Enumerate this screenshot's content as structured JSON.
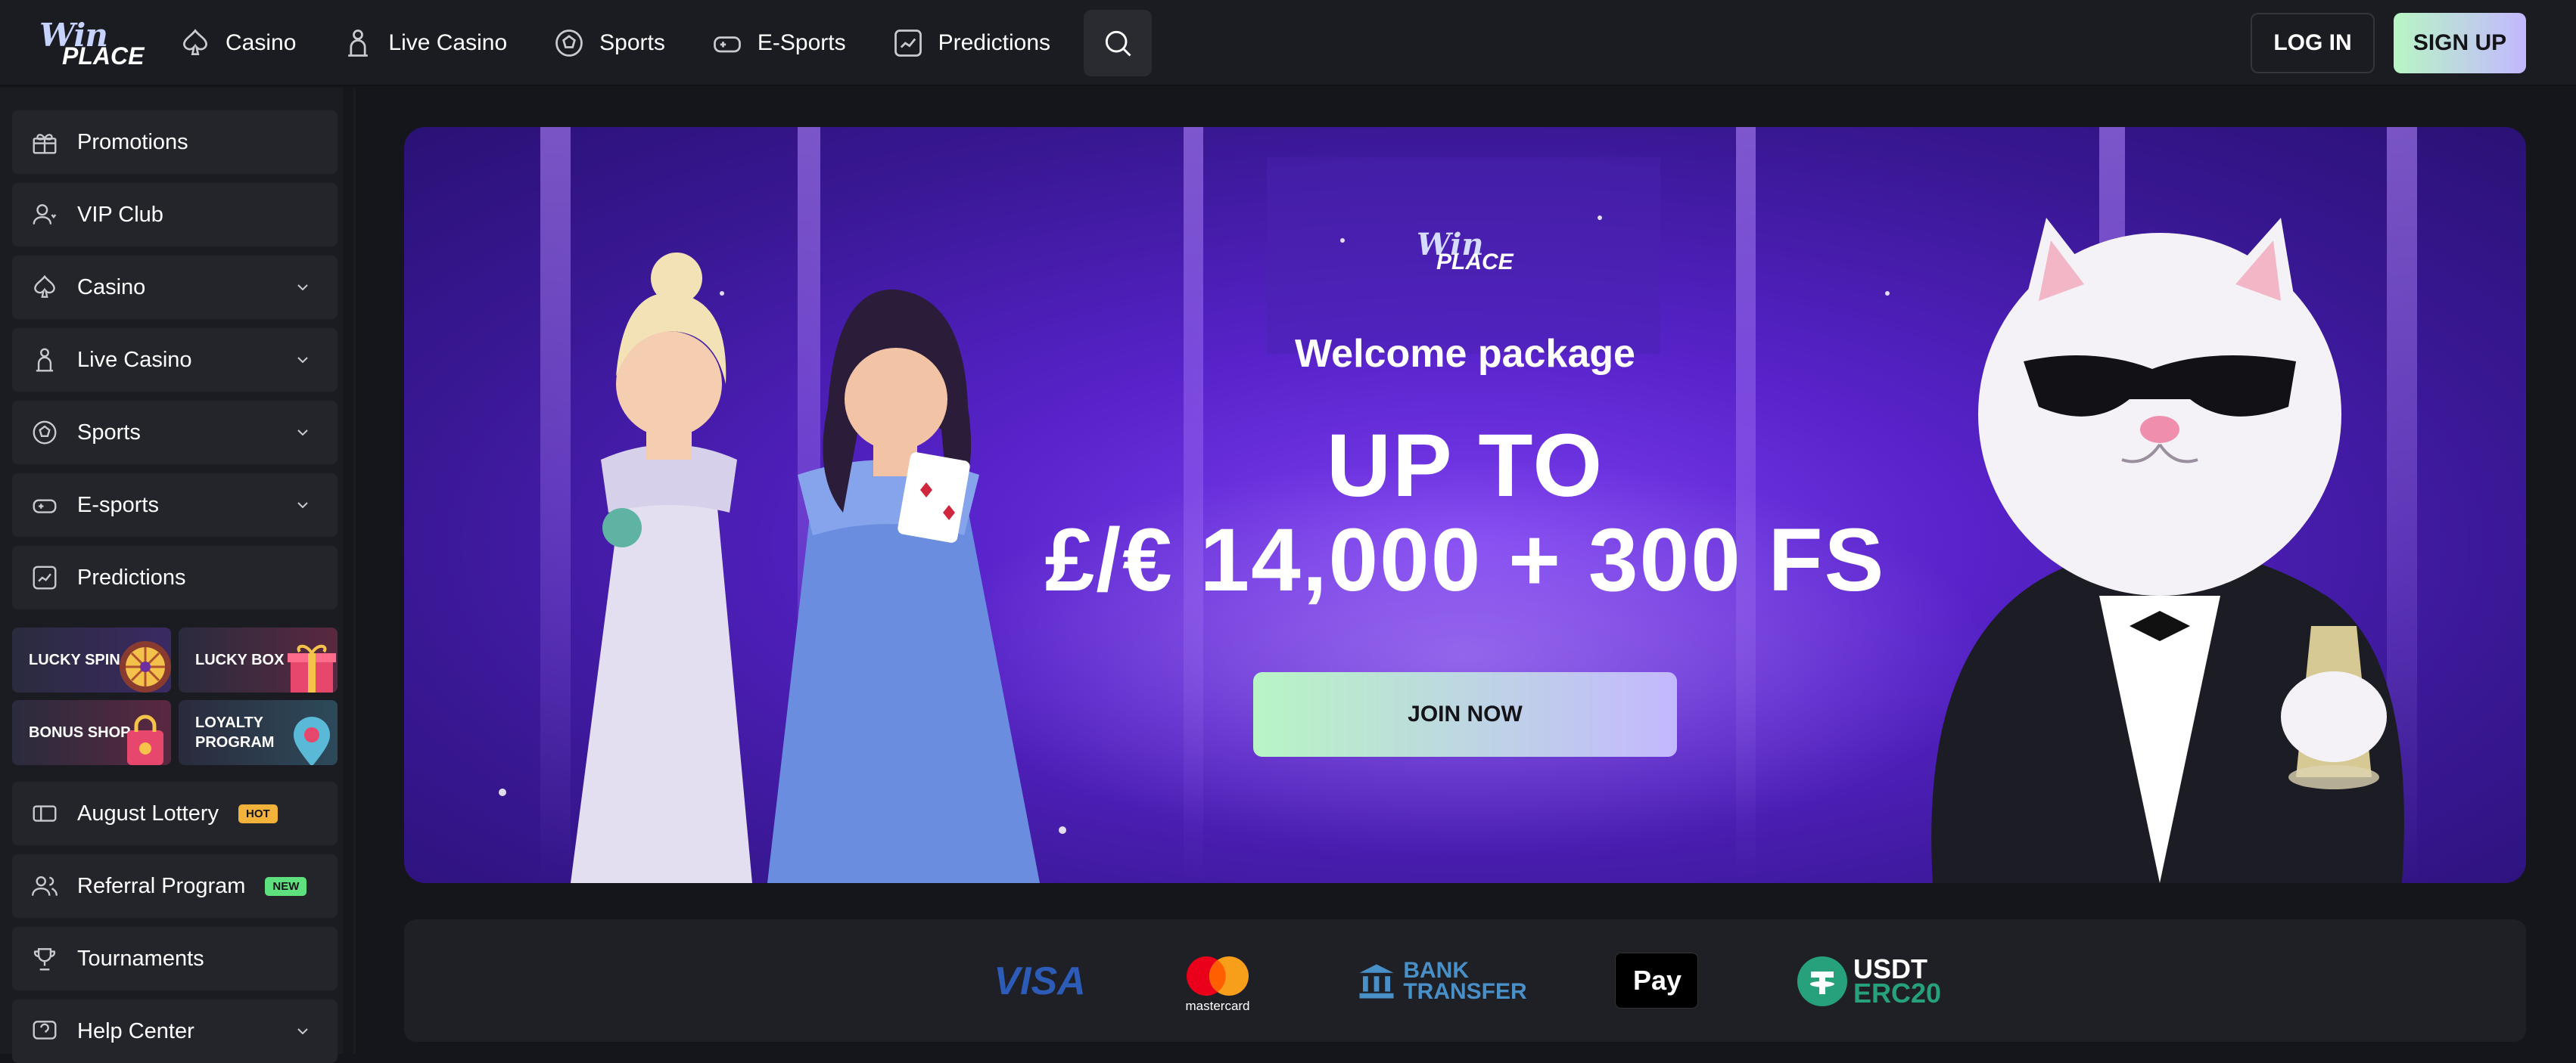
{
  "brand": {
    "logo_line1": "Win",
    "logo_line2": "PLACE"
  },
  "nav": [
    {
      "label": "Casino",
      "icon": "spade-icon"
    },
    {
      "label": "Live Casino",
      "icon": "dealer-icon"
    },
    {
      "label": "Sports",
      "icon": "soccer-ball-icon"
    },
    {
      "label": "E-Sports",
      "icon": "gamepad-icon"
    },
    {
      "label": "Predictions",
      "icon": "chart-icon"
    }
  ],
  "auth": {
    "login_label": "LOG IN",
    "signup_label": "SIGN UP"
  },
  "sidebar": {
    "items": [
      {
        "label": "Promotions",
        "icon": "gift-icon"
      },
      {
        "label": "VIP Club",
        "icon": "vip-icon"
      },
      {
        "label": "Casino",
        "icon": "spade-icon"
      },
      {
        "label": "Live Casino",
        "icon": "dealer-icon"
      },
      {
        "label": "Sports",
        "icon": "soccer-ball-icon"
      },
      {
        "label": "E-sports",
        "icon": "gamepad-icon"
      },
      {
        "label": "Predictions",
        "icon": "chart-icon"
      }
    ],
    "tiles": [
      {
        "label": "LUCKY SPIN"
      },
      {
        "label": "LUCKY BOX"
      },
      {
        "label": "BONUS SHOP"
      },
      {
        "label_line1": "LOYALTY",
        "label_line2": "PROGRAM"
      }
    ],
    "lower_items": [
      {
        "label": "August Lottery",
        "badge": "HOT",
        "icon": "ticket-icon"
      },
      {
        "label": "Referral Program",
        "badge": "NEW",
        "icon": "users-icon"
      },
      {
        "label": "Tournaments",
        "icon": "trophy-icon"
      },
      {
        "label": "Help Center",
        "icon": "help-icon"
      }
    ]
  },
  "hero": {
    "logo_line1": "Win",
    "logo_line2": "PLACE",
    "welcome": "Welcome package",
    "amount_line1": "UP TO",
    "amount_line2": "£/€ 14,000 + 300 FS",
    "cta": "JOIN NOW"
  },
  "payments": {
    "visa": "VISA",
    "mastercard": "mastercard",
    "bank_line1": "BANK",
    "bank_line2": "TRANSFER",
    "applepay": "Pay",
    "usdt_line1": "USDT",
    "usdt_line2": "ERC20"
  },
  "colors": {
    "background": "#15161b",
    "panel": "#1b1c21",
    "item": "#24252b",
    "accent_gradient_start": "#b8f5c4",
    "accent_gradient_end": "#c3b8ff",
    "hero_purple": "#5722c9",
    "hot": "#f3b23a",
    "new": "#5ee07f"
  }
}
